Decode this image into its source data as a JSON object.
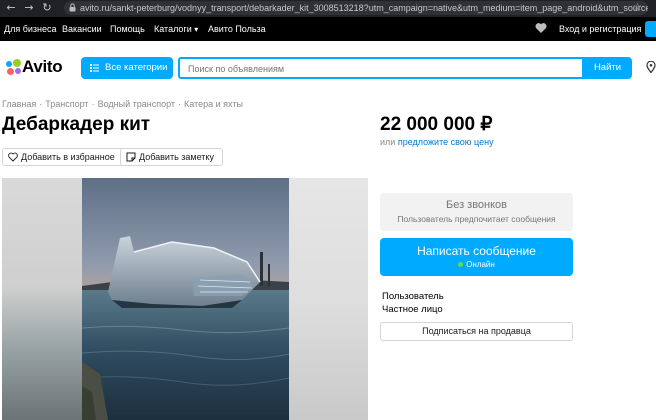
{
  "browser": {
    "url": "avito.ru/sankt-peterburg/vodnyy_transport/debarkader_kit_3008513218?utm_campaign=native&utm_medium=item_page_android&utm_source=so..."
  },
  "top_nav": {
    "links": [
      "Для бизнеса",
      "Вакансии",
      "Помощь",
      "Каталоги",
      "Авито Польза"
    ],
    "catalog_arrow": "▾",
    "login": "Вход и регистрация"
  },
  "header": {
    "logo": "Avito",
    "categories_button": "Все категории",
    "search_placeholder": "Поиск по объявлениям",
    "search_button": "Найти"
  },
  "breadcrumb": [
    "Главная",
    "Транспорт",
    "Водный транспорт",
    "Катера и яхты"
  ],
  "breadcrumb_sep": "·",
  "listing": {
    "title": "Дебаркадер кит",
    "price": "22 000 000 ₽",
    "price_or": "или",
    "price_offer_link": "предложите свою цену",
    "add_favorite": "Добавить в избранное",
    "add_note": "Добавить заметку"
  },
  "contact": {
    "no_calls_title": "Без звонков",
    "no_calls_sub": "Пользователь предпочитает сообщения",
    "message_button": "Написать сообщение",
    "online_status": "Онлайн",
    "seller_name": "Пользователь",
    "seller_type": "Частное лицо",
    "subscribe_button": "Подписаться на продавца"
  },
  "colors": {
    "accent": "#00aaff",
    "link": "#0077d6",
    "online": "#62d84e",
    "nav_bg": "#000000"
  }
}
